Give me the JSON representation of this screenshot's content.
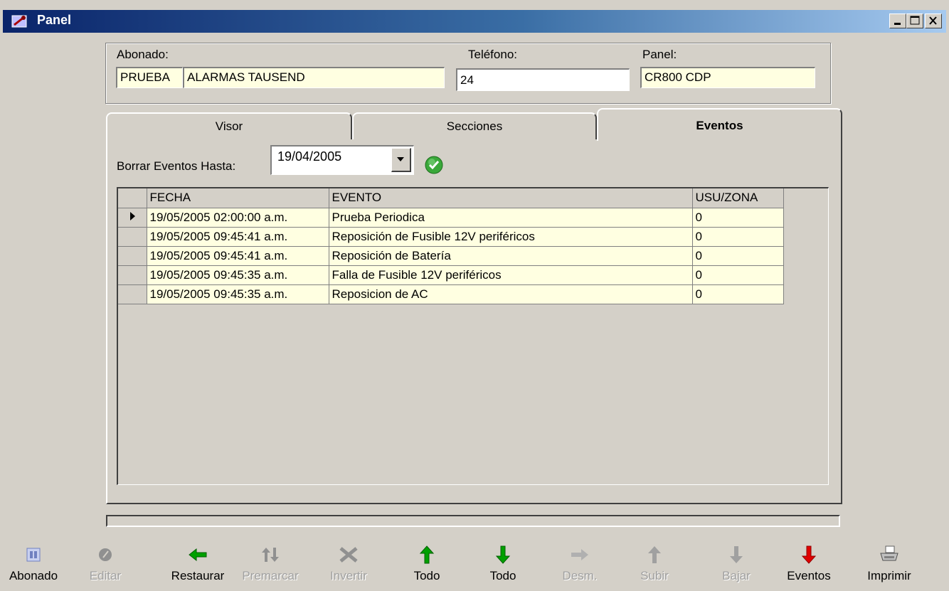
{
  "window": {
    "title": "Panel"
  },
  "header": {
    "abonado_label": "Abonado:",
    "abonado_code": "PRUEBA",
    "abonado_name": "ALARMAS TAUSEND",
    "telefono_label": "Teléfono:",
    "telefono_value": "24",
    "panel_label": "Panel:",
    "panel_value": "CR800 CDP"
  },
  "tabs": [
    {
      "label": "Visor"
    },
    {
      "label": "Secciones"
    },
    {
      "label": "Eventos",
      "active": true
    }
  ],
  "eventos": {
    "borrar_label": "Borrar Eventos Hasta:",
    "borrar_date": "19/04/2005",
    "columns": [
      "FECHA",
      "EVENTO",
      "USU/ZONA"
    ],
    "rows": [
      {
        "fecha": "19/05/2005 02:00:00 a.m.",
        "evento": "Prueba Periodica",
        "usu": "0",
        "current": true
      },
      {
        "fecha": "19/05/2005 09:45:41 a.m.",
        "evento": "Reposición de Fusible 12V periféricos",
        "usu": "0"
      },
      {
        "fecha": "19/05/2005 09:45:41 a.m.",
        "evento": "Reposición de Batería",
        "usu": "0"
      },
      {
        "fecha": "19/05/2005 09:45:35 a.m.",
        "evento": "Falla de Fusible 12V periféricos",
        "usu": "0"
      },
      {
        "fecha": "19/05/2005 09:45:35 a.m.",
        "evento": "Reposicion de AC",
        "usu": "0"
      }
    ]
  },
  "toolbar": [
    {
      "label": "Abonado",
      "icon": "abonado-icon",
      "enabled": true
    },
    {
      "label": "Editar",
      "icon": "edit-icon",
      "enabled": false
    },
    {
      "label": "Restaurar",
      "icon": "arrow-left-icon",
      "enabled": true
    },
    {
      "label": "Premarcar",
      "icon": "swap-vertical-icon",
      "enabled": false
    },
    {
      "label": "Invertir",
      "icon": "invert-icon",
      "enabled": false
    },
    {
      "label": "Todo",
      "icon": "arrow-up-icon",
      "enabled": true
    },
    {
      "label": "Todo",
      "icon": "arrow-down-icon",
      "enabled": true
    },
    {
      "label": "Desm.",
      "icon": "arrow-right-icon",
      "enabled": false
    },
    {
      "label": "Subir",
      "icon": "arrow-up-gray-icon",
      "enabled": false
    },
    {
      "label": "Bajar",
      "icon": "arrow-down-gray-icon",
      "enabled": false
    },
    {
      "label": "Eventos",
      "icon": "arrow-down-red-icon",
      "enabled": true
    },
    {
      "label": "Imprimir",
      "icon": "printer-icon",
      "enabled": true
    }
  ],
  "colors": {
    "green": "#00a000",
    "red": "#e00000",
    "disabled": "#a0a0a0",
    "grid_cell": "#ffffe1"
  }
}
